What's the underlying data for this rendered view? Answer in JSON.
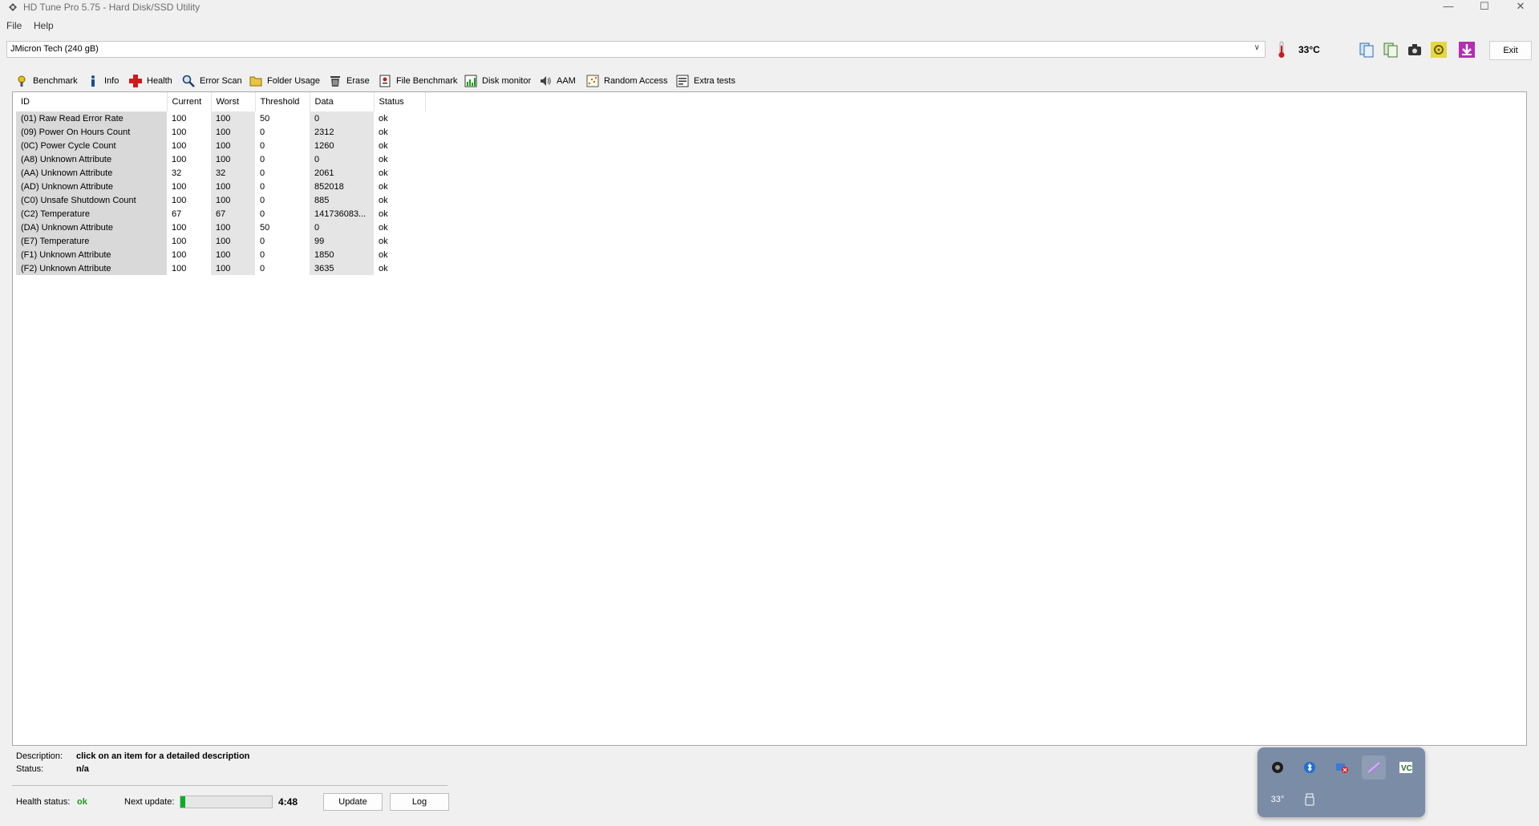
{
  "window": {
    "title": "HD Tune Pro 5.75 - Hard Disk/SSD Utility",
    "minimize": "—",
    "maximize": "☐",
    "close": "✕"
  },
  "menu": {
    "file": "File",
    "help": "Help"
  },
  "toolbar": {
    "drive": "JMicron Tech (240 gB)",
    "temperature": "33°C",
    "exit_label": "Exit"
  },
  "tabs": [
    {
      "label": "Benchmark",
      "icon": "benchmark-icon"
    },
    {
      "label": "Info",
      "icon": "info-icon"
    },
    {
      "label": "Health",
      "icon": "health-icon"
    },
    {
      "label": "Error Scan",
      "icon": "error-scan-icon"
    },
    {
      "label": "Folder Usage",
      "icon": "folder-icon"
    },
    {
      "label": "Erase",
      "icon": "erase-icon"
    },
    {
      "label": "File Benchmark",
      "icon": "file-benchmark-icon"
    },
    {
      "label": "Disk monitor",
      "icon": "disk-monitor-icon"
    },
    {
      "label": "AAM",
      "icon": "speaker-icon"
    },
    {
      "label": "Random Access",
      "icon": "random-access-icon"
    },
    {
      "label": "Extra tests",
      "icon": "extra-tests-icon"
    }
  ],
  "table": {
    "headers": [
      "ID",
      "Current",
      "Worst",
      "Threshold",
      "Data",
      "Status"
    ],
    "rows": [
      [
        "(01) Raw Read Error Rate",
        "100",
        "100",
        "50",
        "0",
        "ok"
      ],
      [
        "(09) Power On Hours Count",
        "100",
        "100",
        "0",
        "2312",
        "ok"
      ],
      [
        "(0C) Power Cycle Count",
        "100",
        "100",
        "0",
        "1260",
        "ok"
      ],
      [
        "(A8) Unknown Attribute",
        "100",
        "100",
        "0",
        "0",
        "ok"
      ],
      [
        "(AA) Unknown Attribute",
        "32",
        "32",
        "0",
        "2061",
        "ok"
      ],
      [
        "(AD) Unknown Attribute",
        "100",
        "100",
        "0",
        "852018",
        "ok"
      ],
      [
        "(C0) Unsafe Shutdown Count",
        "100",
        "100",
        "0",
        "885",
        "ok"
      ],
      [
        "(C2) Temperature",
        "67",
        "67",
        "0",
        "141736083...",
        "ok"
      ],
      [
        "(DA) Unknown Attribute",
        "100",
        "100",
        "50",
        "0",
        "ok"
      ],
      [
        "(E7) Temperature",
        "100",
        "100",
        "0",
        "99",
        "ok"
      ],
      [
        "(F1) Unknown Attribute",
        "100",
        "100",
        "0",
        "1850",
        "ok"
      ],
      [
        "(F2) Unknown Attribute",
        "100",
        "100",
        "0",
        "3635",
        "ok"
      ]
    ]
  },
  "bottom": {
    "description_label": "Description:",
    "description_value": "click on an item for a detailed description",
    "status_label": "Status:",
    "status_value": "n/a",
    "health_label": "Health status:",
    "health_value": "ok",
    "health_color": "#1a9b1a",
    "next_update_label": "Next update:",
    "next_update_progress": 0.05,
    "next_update_time": "4:48",
    "update_button": "Update",
    "log_button": "Log"
  },
  "tray": {
    "temperature": "33°"
  }
}
